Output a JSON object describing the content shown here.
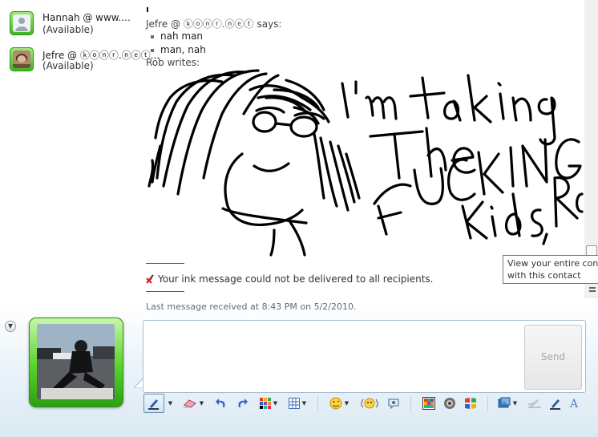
{
  "contacts": [
    {
      "name": "Hannah @ www....",
      "status": "(Available)"
    },
    {
      "name": "Jefre @ ⓚⓞⓝⓡ.ⓝⓔⓣ...",
      "status": "(Available)"
    }
  ],
  "conversation": {
    "sender1": "Jefre @ ⓚⓞⓝⓡ.ⓝⓔⓣ says:",
    "messages": [
      "nah man",
      "man, nah"
    ],
    "sender2": "Rob writes:",
    "ink_text": [
      "I'm taking",
      "The",
      "FUCKING",
      "Kids, Rob"
    ],
    "notice": "Your ink message could not be delivered to all recipients.",
    "last_message": "Last message received at 8:43 PM on 5/2/2010."
  },
  "tooltip": {
    "line1": "View your entire conv",
    "line2": "with this contact"
  },
  "input": {
    "value": "",
    "send_label": "Send"
  },
  "colors": {
    "accent_green": "#3cb81e",
    "border_blue": "#a9bccd",
    "toolbar_bg": "#e4eef7"
  },
  "toolbar_icons": [
    "ink-pen-icon",
    "eraser-icon",
    "undo-icon",
    "redo-icon",
    "color-grid-icon",
    "grid-icon",
    "emoticon-icon",
    "wink-icon",
    "nudge-icon",
    "background-icon",
    "voice-clip-icon",
    "games-icon",
    "photo-share-icon",
    "handwriting-icon",
    "ink-pen-small-icon",
    "font-icon"
  ]
}
